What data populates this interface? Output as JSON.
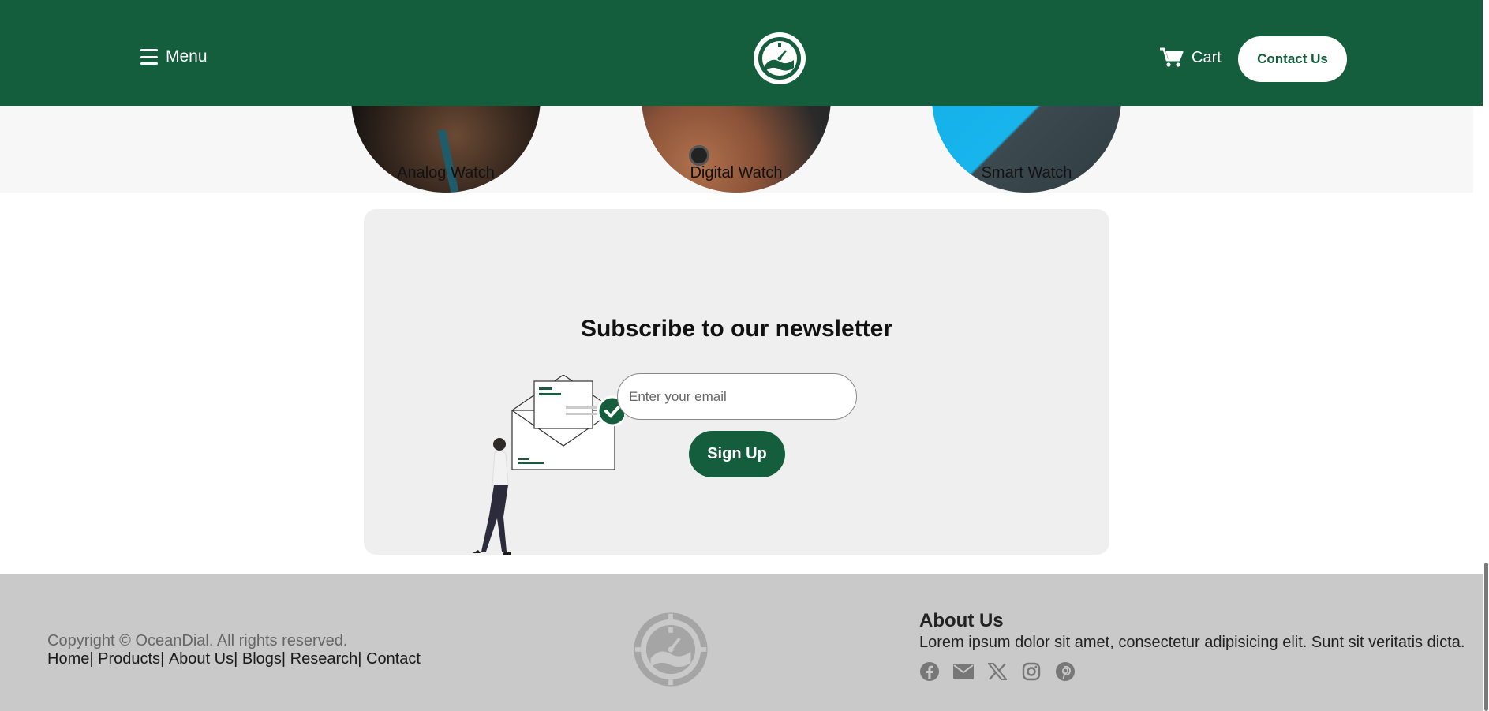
{
  "header": {
    "menu_label": "Menu",
    "cart_label": "Cart",
    "contact_label": "Contact Us",
    "menu_icon": "hamburger-icon",
    "cart_icon": "shopping-cart-icon",
    "logo_icon": "oceandial-logo-icon"
  },
  "categories": [
    {
      "label": "Analog Watch"
    },
    {
      "label": "Digital Watch"
    },
    {
      "label": "Smart Watch"
    }
  ],
  "newsletter": {
    "title": "Subscribe to our newsletter",
    "email_placeholder": "Enter your email",
    "signup_label": "Sign Up"
  },
  "footer": {
    "copyright": "Copyright © OceanDial. All rights reserved.",
    "links": [
      {
        "label": "Home"
      },
      {
        "label": "Products"
      },
      {
        "label": "About Us"
      },
      {
        "label": "Blogs"
      },
      {
        "label": "Research"
      },
      {
        "label": "Contact"
      }
    ],
    "about_title": "About Us",
    "about_text": "Lorem ipsum dolor sit amet, consectetur adipisicing elit. Sunt sit veritatis dicta.",
    "social_icons": [
      "facebook-icon",
      "email-icon",
      "x-icon",
      "instagram-icon",
      "pinterest-icon"
    ]
  },
  "colors": {
    "brand_green": "#145e3e",
    "footer_gray": "#c9c9c9",
    "panel_gray": "#efefef"
  }
}
